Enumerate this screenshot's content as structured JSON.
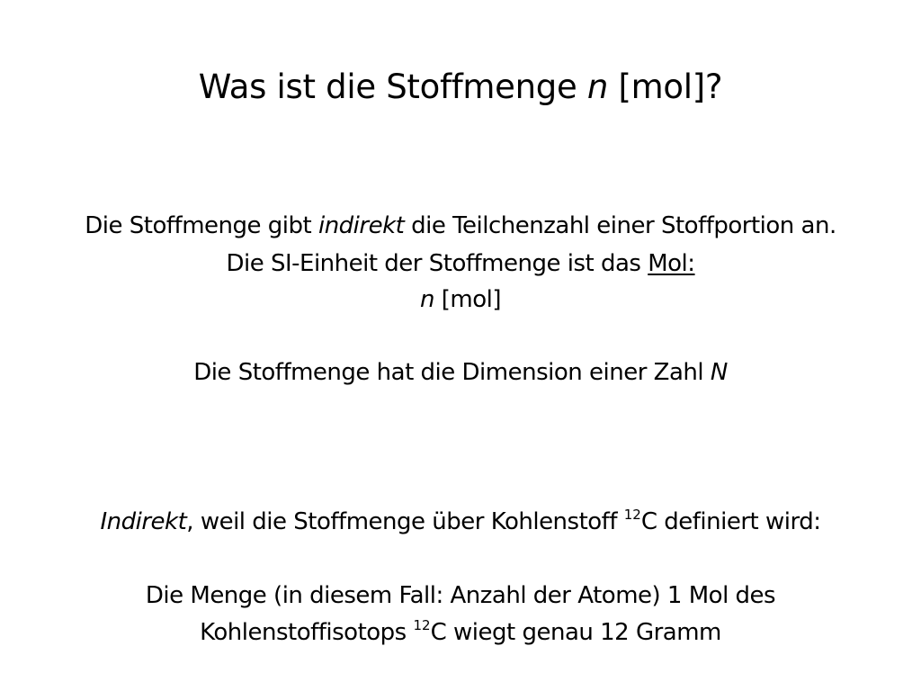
{
  "slide": {
    "title": {
      "prefix": "Was ist die Stoffmenge ",
      "symbol": "n",
      "suffix": " [mol]?"
    },
    "definition": {
      "line1": {
        "a": "Die Stoffmenge gibt ",
        "em": "indirekt",
        "b": " die Teilchenzahl einer Stoffportion an."
      },
      "line2": {
        "a": "Die SI-Einheit der Stoffmenge ist das ",
        "link": "Mol:"
      },
      "line3": {
        "symbol": "n",
        "b": " [mol]"
      }
    },
    "dimension": {
      "a": "Die Stoffmenge hat die Dimension einer Zahl ",
      "symbol": "N"
    },
    "explanation": {
      "line1": {
        "em": "Indirekt",
        "a": ", weil die Stoffmenge über Kohlenstoff ",
        "sup": "12",
        "b": "C definiert wird:"
      },
      "line2": {
        "a": "Die Menge (in diesem Fall: Anzahl der Atome) 1 Mol des"
      },
      "line3": {
        "a": "Kohlenstoffisotops ",
        "sup": "12",
        "b": "C wiegt genau 12 Gramm"
      }
    }
  }
}
